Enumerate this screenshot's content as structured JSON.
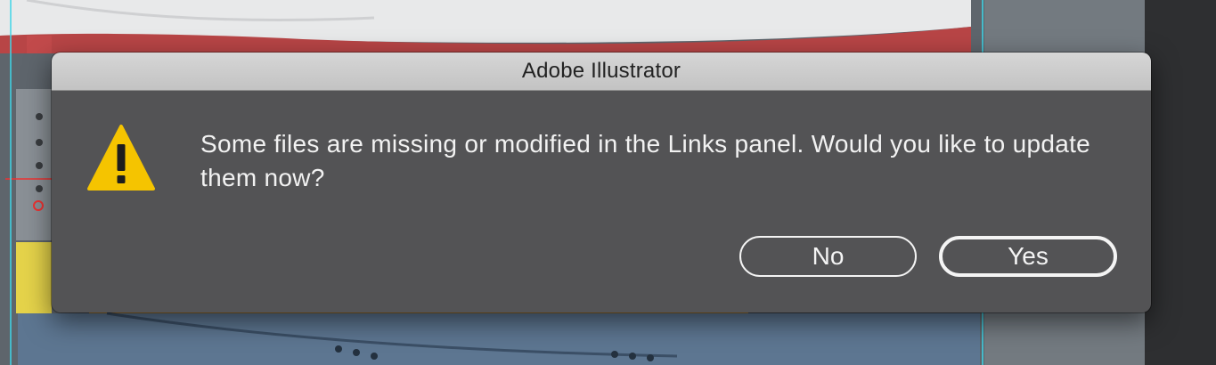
{
  "dialog": {
    "title": "Adobe Illustrator",
    "message": "Some files are missing or modified in the Links panel. Would you like to update them now?",
    "icon": "warning-icon",
    "buttons": {
      "no_label": "No",
      "yes_label": "Yes"
    }
  },
  "colors": {
    "dialog_body": "#535355",
    "titlebar": "#c8c8c8",
    "warning_yellow": "#f5c400",
    "button_outline": "#f4f4f4"
  }
}
